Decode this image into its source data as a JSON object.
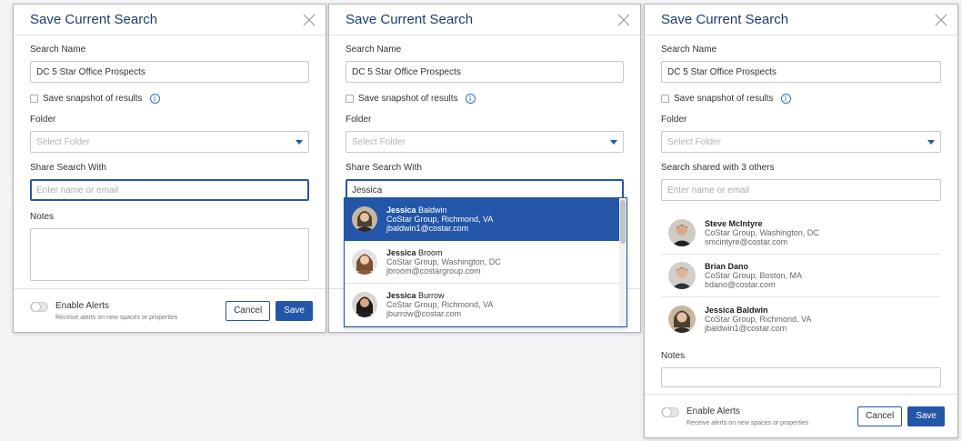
{
  "common": {
    "title": "Save Current Search",
    "search_name_label": "Search Name",
    "search_name_value": "DC 5 Star Office Prospects",
    "snapshot_label": "Save snapshot of results",
    "info_glyph": "i",
    "folder_label": "Folder",
    "folder_placeholder": "Select Folder",
    "share_label": "Share Search With",
    "share_placeholder": "Enter name or email",
    "notes_label": "Notes",
    "alerts_title": "Enable Alerts",
    "alerts_sub": "Receive alerts on new spaces or properties",
    "cancel_label": "Cancel",
    "save_label": "Save"
  },
  "dialog2": {
    "share_value": "Jessica",
    "suggestions": [
      {
        "first": "Jessica",
        "last": " Baldwin",
        "org": "CoStar Group, Richmond, VA",
        "email": "jbaldwin1@costar.com",
        "active": true
      },
      {
        "first": "Jessica",
        "last": " Broom",
        "org": "CoStar Group, Washington, DC",
        "email": "jbroom@costargroup.com",
        "active": false
      },
      {
        "first": "Jessica",
        "last": " Burrow",
        "org": "CoStar Group, Richmond, VA",
        "email": "jburrow@costar.com",
        "active": false
      }
    ]
  },
  "dialog3": {
    "shared_label": "Search shared with 3 others",
    "shared": [
      {
        "name": "Steve McIntyre",
        "org": "CoStar Group, Washington, DC",
        "email": "smcintyre@costar.com"
      },
      {
        "name": "Brian Dano",
        "org": "CoStar Group, Boston, MA",
        "email": "bdano@costar.com"
      },
      {
        "name": "Jessica Baldwin",
        "org": "CoStar Group, Richmond, VA",
        "email": "jbaldwin1@costar.com"
      }
    ]
  },
  "colors": {
    "brand_blue": "#2356a8",
    "title_blue": "#1b3d73"
  },
  "icons": {
    "close": "close-icon",
    "info": "info-icon",
    "dropdown": "chevron-down-icon",
    "avatar": "avatar"
  }
}
